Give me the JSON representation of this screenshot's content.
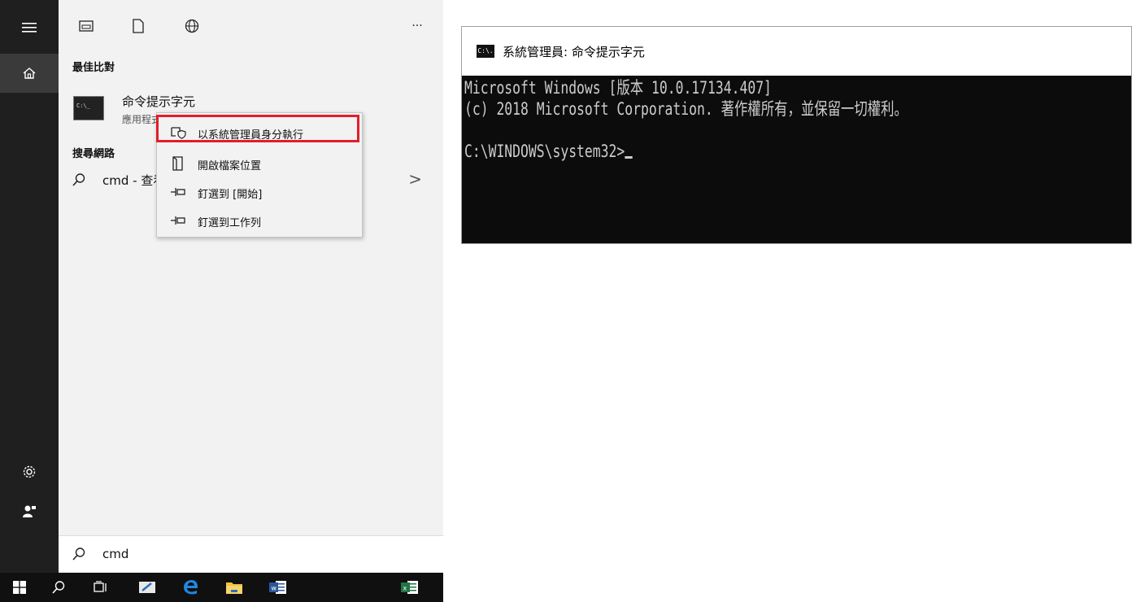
{
  "start_menu": {
    "best_match_header": "最佳比對",
    "app_name": "命令提示字元",
    "app_type": "應用程式",
    "web_header": "搜尋網路",
    "web_result": "cmd - 查看網路搜尋結果",
    "more": "···",
    "search_text": "cmd"
  },
  "context_menu": {
    "items": [
      {
        "label": "以系統管理員身分執行",
        "icon": "shield-run-icon"
      },
      {
        "label": "開啟檔案位置",
        "icon": "folder-open-icon"
      },
      {
        "label": "釘選到 [開始]",
        "icon": "pin-icon"
      },
      {
        "label": "釘選到工作列",
        "icon": "pin-icon"
      }
    ],
    "highlight_color": "#e21e2a"
  },
  "cmd_window": {
    "title_icon": "C:\\.",
    "title": "系統管理員: 命令提示字元",
    "line1": "Microsoft Windows [版本 10.0.17134.407]",
    "line2": "(c) 2018 Microsoft Corporation. 著作權所有，並保留一切權利。",
    "line3": "",
    "prompt": "C:\\WINDOWS\\system32>"
  },
  "icons": {
    "rail": [
      "hamburger-icon",
      "home-icon",
      "settings-icon",
      "user-icon"
    ],
    "topbar": [
      "apps-icon",
      "document-icon",
      "web-icon"
    ],
    "taskbar": [
      "windows-logo-icon",
      "search-icon",
      "task-view-icon",
      "whiteboard-icon",
      "edge-icon",
      "file-explorer-icon",
      "word-icon",
      "excel-icon"
    ]
  },
  "colors": {
    "rail_bg": "#1f1f1f",
    "panel_bg": "#f2f2f2",
    "taskbar_bg": "#101010",
    "console_bg": "#0c0c0c",
    "console_fg": "#cccccc"
  }
}
